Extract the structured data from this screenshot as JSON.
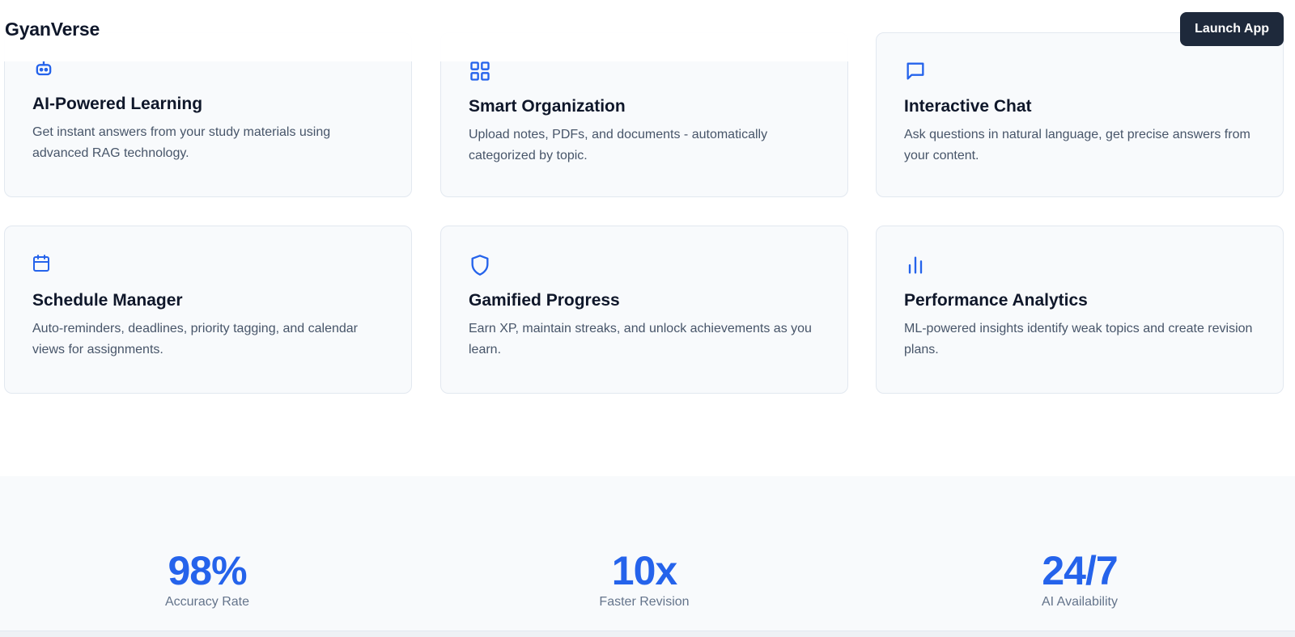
{
  "header": {
    "brand": "GyanVerse",
    "launch_label": "Launch App"
  },
  "features": [
    {
      "icon": "robot-icon",
      "title": "AI-Powered Learning",
      "desc": "Get instant answers from your study materials using advanced RAG technology."
    },
    {
      "icon": "grid-icon",
      "title": "Smart Organization",
      "desc": "Upload notes, PDFs, and documents - automatically categorized by topic."
    },
    {
      "icon": "chat-icon",
      "title": "Interactive Chat",
      "desc": "Ask questions in natural language, get precise answers from your content."
    },
    {
      "icon": "calendar-icon",
      "title": "Schedule Manager",
      "desc": "Auto-reminders, deadlines, priority tagging, and calendar views for assignments."
    },
    {
      "icon": "shield-icon",
      "title": "Gamified Progress",
      "desc": "Earn XP, maintain streaks, and unlock achievements as you learn."
    },
    {
      "icon": "bar-chart-icon",
      "title": "Performance Analytics",
      "desc": "ML-powered insights identify weak topics and create revision plans."
    }
  ],
  "stats": [
    {
      "value": "98%",
      "label": "Accuracy Rate"
    },
    {
      "value": "10x",
      "label": "Faster Revision"
    },
    {
      "value": "24/7",
      "label": "AI Availability"
    }
  ],
  "colors": {
    "accent": "#2563eb",
    "dark": "#1e293b",
    "card_bg": "#f8fafc",
    "border": "#e2e8f0"
  }
}
